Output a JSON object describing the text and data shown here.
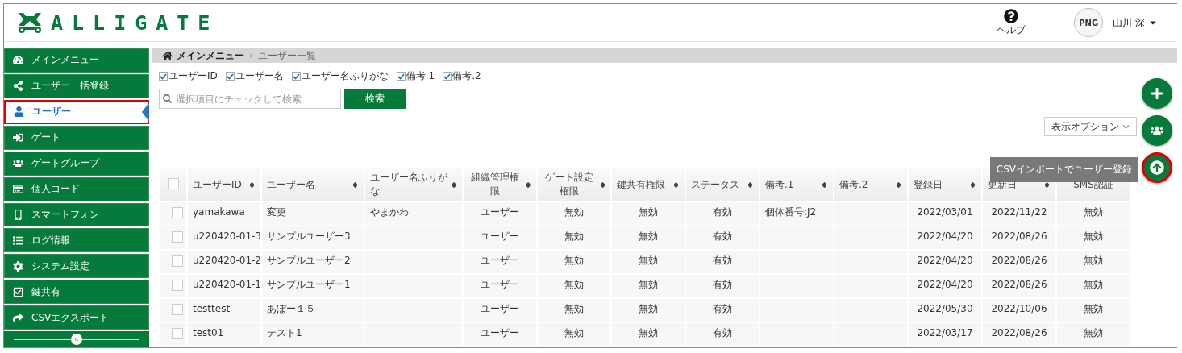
{
  "header": {
    "logo": "ALLIGATE",
    "help": "ヘルプ",
    "avatar_label": "PNG",
    "user": "山川 深"
  },
  "sidebar": {
    "items": [
      {
        "label": "メインメニュー",
        "selected": false
      },
      {
        "label": "ユーザー一括登録",
        "selected": false
      },
      {
        "label": "ユーザー",
        "selected": true
      },
      {
        "label": "ゲート",
        "selected": false
      },
      {
        "label": "ゲートグループ",
        "selected": false
      },
      {
        "label": "個人コード",
        "selected": false
      },
      {
        "label": "スマートフォン",
        "selected": false
      },
      {
        "label": "ログ情報",
        "selected": false
      },
      {
        "label": "システム設定",
        "selected": false
      },
      {
        "label": "鍵共有",
        "selected": false
      },
      {
        "label": "CSVエクスポート",
        "selected": false
      }
    ],
    "collapse": "«"
  },
  "breadcrumb": {
    "home": "メインメニュー",
    "separator": "›",
    "current": "ユーザー一覧"
  },
  "filters": [
    {
      "label": "ユーザーID",
      "checked": true
    },
    {
      "label": "ユーザー名",
      "checked": true
    },
    {
      "label": "ユーザー名ふりがな",
      "checked": true
    },
    {
      "label": "備考.1",
      "checked": true
    },
    {
      "label": "備考.2",
      "checked": true
    }
  ],
  "search": {
    "placeholder": "選択項目にチェックして検索",
    "button": "検索"
  },
  "display_options": "表示オプション",
  "table": {
    "all_checked": false,
    "columns": [
      {
        "label": "ユーザーID",
        "sortable": true
      },
      {
        "label": "ユーザー名",
        "sortable": true
      },
      {
        "label": "ユーザー名ふりがな",
        "sortable": true
      },
      {
        "label": "組織管理権限",
        "sortable": true
      },
      {
        "label": "ゲート設定権限",
        "sortable": true
      },
      {
        "label": "鍵共有権限",
        "sortable": true
      },
      {
        "label": "ステータス",
        "sortable": true
      },
      {
        "label": "備考.1",
        "sortable": true
      },
      {
        "label": "備考.2",
        "sortable": true
      },
      {
        "label": "登録日",
        "sortable": true
      },
      {
        "label": "更新日",
        "sortable": true
      },
      {
        "label": "SMS認証",
        "sortable": false
      }
    ],
    "rows": [
      {
        "checked": false,
        "cells": [
          "yamakawa",
          "変更",
          "やまかわ",
          "ユーザー",
          "無効",
          "無効",
          "有効",
          "個体番号:J2",
          "",
          "2022/03/01",
          "2022/11/22",
          "無効"
        ]
      },
      {
        "checked": false,
        "cells": [
          "u220420-01-3",
          "サンプルユーザー3",
          "",
          "ユーザー",
          "無効",
          "無効",
          "有効",
          "",
          "",
          "2022/04/20",
          "2022/08/26",
          "無効"
        ]
      },
      {
        "checked": false,
        "cells": [
          "u220420-01-2",
          "サンプルユーザー2",
          "",
          "ユーザー",
          "無効",
          "無効",
          "有効",
          "",
          "",
          "2022/04/20",
          "2022/08/26",
          "無効"
        ]
      },
      {
        "checked": false,
        "cells": [
          "u220420-01-1",
          "サンプルユーザー1",
          "",
          "ユーザー",
          "無効",
          "無効",
          "有効",
          "",
          "",
          "2022/04/20",
          "2022/08/26",
          "無効"
        ]
      },
      {
        "checked": false,
        "cells": [
          "testtest",
          "あぽー１５",
          "",
          "ユーザー",
          "無効",
          "無効",
          "有効",
          "",
          "",
          "2022/05/30",
          "2022/10/06",
          "無効"
        ]
      },
      {
        "checked": false,
        "cells": [
          "test01",
          "テスト1",
          "",
          "ユーザー",
          "無効",
          "無効",
          "有効",
          "",
          "",
          "2022/03/17",
          "2022/08/26",
          "無効"
        ]
      }
    ]
  },
  "fab_buttons": [
    {
      "highlighted": false
    },
    {
      "highlighted": false
    },
    {
      "highlighted": true,
      "tooltip": "CSVインポートでユーザー登録"
    }
  ]
}
